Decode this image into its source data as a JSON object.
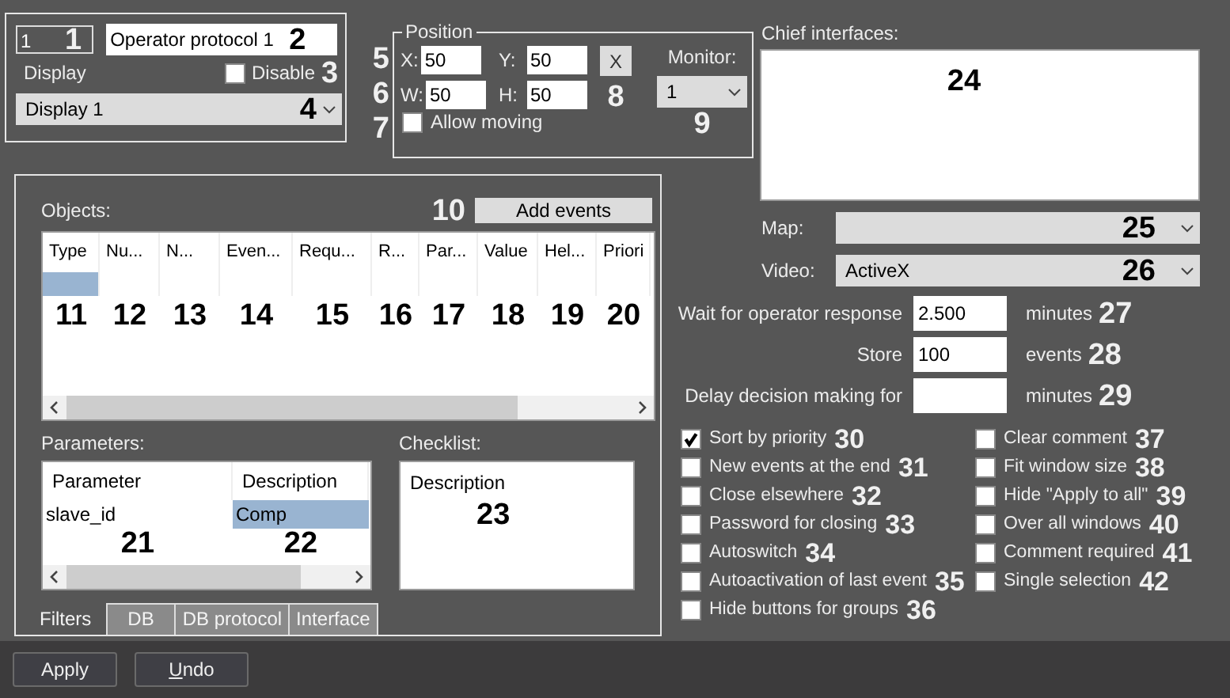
{
  "general": {
    "number": "1",
    "number_callout": "1",
    "name": "Operator protocol 1",
    "name_callout": "2",
    "display_label": "Display",
    "disable": {
      "label": "Disable",
      "checked": false,
      "callout": "3"
    },
    "display": {
      "value": "Display 1",
      "callout": "4"
    }
  },
  "position": {
    "title": "Position",
    "fields": [
      {
        "label": "X:",
        "value": "50"
      },
      {
        "label": "Y:",
        "value": "50"
      },
      {
        "label": "W:",
        "value": "50"
      },
      {
        "label": "H:",
        "value": "50"
      }
    ],
    "row_callouts": [
      "5",
      "6"
    ],
    "reset_button": {
      "label": "X",
      "callout": "8"
    },
    "monitor": {
      "label": "Monitor:",
      "value": "1",
      "callout": "9"
    },
    "allow_moving": {
      "label": "Allow moving",
      "checked": false,
      "callout": "7"
    }
  },
  "objects": {
    "label": "Objects:",
    "add_button": {
      "label": "Add events",
      "callout": "10"
    },
    "columns": [
      {
        "label": "Type",
        "callout": "11"
      },
      {
        "label": "Nu...",
        "callout": "12"
      },
      {
        "label": "N...",
        "callout": "13"
      },
      {
        "label": "Even...",
        "callout": "14"
      },
      {
        "label": "Requ...",
        "callout": "15"
      },
      {
        "label": "R...",
        "callout": "16"
      },
      {
        "label": "Par...",
        "callout": "17"
      },
      {
        "label": "Value",
        "callout": "18"
      },
      {
        "label": "Hel...",
        "callout": "19"
      },
      {
        "label": "Priori",
        "callout": "20"
      }
    ],
    "rows": [
      {
        "selected": true
      }
    ]
  },
  "parameters": {
    "label": "Parameters:",
    "columns": [
      {
        "label": "Parameter",
        "callout": "21"
      },
      {
        "label": "Description",
        "callout": "22"
      }
    ],
    "rows": [
      {
        "cells": [
          {
            "text": "slave_id",
            "selected": false
          },
          {
            "text": "Comp",
            "selected": true
          }
        ]
      }
    ]
  },
  "checklist": {
    "label": "Checklist:",
    "column": "Description",
    "callout": "23"
  },
  "tabs": [
    {
      "label": "Filters",
      "selected": true
    },
    {
      "label": "DB",
      "selected": false
    },
    {
      "label": "DB protocol",
      "selected": false
    },
    {
      "label": "Interface",
      "selected": false
    }
  ],
  "chief": {
    "label": "Chief interfaces:",
    "callout": "24"
  },
  "map": {
    "label": "Map:",
    "callout": "25"
  },
  "video": {
    "label": "Video:",
    "value": "ActiveX",
    "callout": "26"
  },
  "timings": [
    {
      "label": "Wait for operator response",
      "value": "2.500",
      "unit": "minutes",
      "callout": "27"
    },
    {
      "label": "Store",
      "value": "100",
      "unit": "events",
      "callout": "28"
    },
    {
      "label": "Delay decision making for",
      "unit": "minutes",
      "callout": "29"
    }
  ],
  "options": [
    {
      "label": "Sort by priority",
      "checked": true,
      "callout": "30"
    },
    {
      "label": "New events at the end",
      "checked": false,
      "callout": "31"
    },
    {
      "label": "Close elsewhere",
      "checked": false,
      "callout": "32"
    },
    {
      "label": "Password for closing",
      "checked": false,
      "callout": "33"
    },
    {
      "label": "Autoswitch",
      "checked": false,
      "callout": "34"
    },
    {
      "label": "Autoactivation of last event",
      "checked": false,
      "callout": "35"
    },
    {
      "label": "Hide buttons for groups",
      "checked": false,
      "callout": "36"
    },
    {
      "label": "Clear comment",
      "checked": false,
      "callout": "37"
    },
    {
      "label": "Fit window size",
      "checked": false,
      "callout": "38"
    },
    {
      "label": "Hide \"Apply to all\"",
      "checked": false,
      "callout": "39"
    },
    {
      "label": "Over all windows",
      "checked": false,
      "callout": "40"
    },
    {
      "label": "Comment required",
      "checked": false,
      "callout": "41"
    },
    {
      "label": "Single selection",
      "checked": false,
      "callout": "42"
    }
  ],
  "buttons": [
    {
      "label": "Apply",
      "access_key_underlined": false
    },
    {
      "label": "Undo",
      "access_key_underlined": true
    }
  ]
}
